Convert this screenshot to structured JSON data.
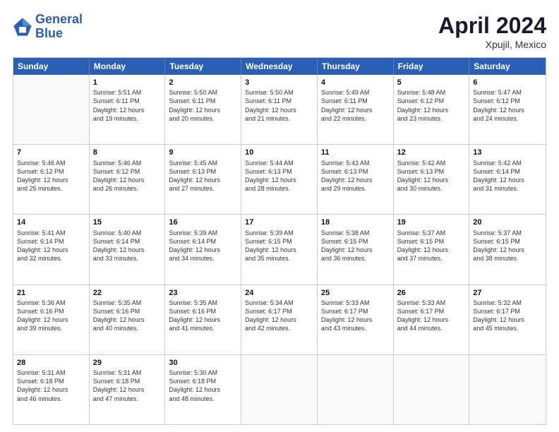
{
  "header": {
    "logo_general": "General",
    "logo_blue": "Blue",
    "title": "April 2024",
    "subtitle": "Xpujil, Mexico"
  },
  "days_of_week": [
    "Sunday",
    "Monday",
    "Tuesday",
    "Wednesday",
    "Thursday",
    "Friday",
    "Saturday"
  ],
  "weeks": [
    [
      {
        "day": "",
        "info": ""
      },
      {
        "day": "1",
        "info": "Sunrise: 5:51 AM\nSunset: 6:11 PM\nDaylight: 12 hours\nand 19 minutes."
      },
      {
        "day": "2",
        "info": "Sunrise: 5:50 AM\nSunset: 6:11 PM\nDaylight: 12 hours\nand 20 minutes."
      },
      {
        "day": "3",
        "info": "Sunrise: 5:50 AM\nSunset: 6:11 PM\nDaylight: 12 hours\nand 21 minutes."
      },
      {
        "day": "4",
        "info": "Sunrise: 5:49 AM\nSunset: 6:11 PM\nDaylight: 12 hours\nand 22 minutes."
      },
      {
        "day": "5",
        "info": "Sunrise: 5:48 AM\nSunset: 6:12 PM\nDaylight: 12 hours\nand 23 minutes."
      },
      {
        "day": "6",
        "info": "Sunrise: 5:47 AM\nSunset: 6:12 PM\nDaylight: 12 hours\nand 24 minutes."
      }
    ],
    [
      {
        "day": "7",
        "info": "Sunrise: 5:46 AM\nSunset: 6:12 PM\nDaylight: 12 hours\nand 25 minutes."
      },
      {
        "day": "8",
        "info": "Sunrise: 5:46 AM\nSunset: 6:12 PM\nDaylight: 12 hours\nand 26 minutes."
      },
      {
        "day": "9",
        "info": "Sunrise: 5:45 AM\nSunset: 6:13 PM\nDaylight: 12 hours\nand 27 minutes."
      },
      {
        "day": "10",
        "info": "Sunrise: 5:44 AM\nSunset: 6:13 PM\nDaylight: 12 hours\nand 28 minutes."
      },
      {
        "day": "11",
        "info": "Sunrise: 5:43 AM\nSunset: 6:13 PM\nDaylight: 12 hours\nand 29 minutes."
      },
      {
        "day": "12",
        "info": "Sunrise: 5:42 AM\nSunset: 6:13 PM\nDaylight: 12 hours\nand 30 minutes."
      },
      {
        "day": "13",
        "info": "Sunrise: 5:42 AM\nSunset: 6:14 PM\nDaylight: 12 hours\nand 31 minutes."
      }
    ],
    [
      {
        "day": "14",
        "info": "Sunrise: 5:41 AM\nSunset: 6:14 PM\nDaylight: 12 hours\nand 32 minutes."
      },
      {
        "day": "15",
        "info": "Sunrise: 5:40 AM\nSunset: 6:14 PM\nDaylight: 12 hours\nand 33 minutes."
      },
      {
        "day": "16",
        "info": "Sunrise: 5:39 AM\nSunset: 6:14 PM\nDaylight: 12 hours\nand 34 minutes."
      },
      {
        "day": "17",
        "info": "Sunrise: 5:39 AM\nSunset: 6:15 PM\nDaylight: 12 hours\nand 35 minutes."
      },
      {
        "day": "18",
        "info": "Sunrise: 5:38 AM\nSunset: 6:15 PM\nDaylight: 12 hours\nand 36 minutes."
      },
      {
        "day": "19",
        "info": "Sunrise: 5:37 AM\nSunset: 6:15 PM\nDaylight: 12 hours\nand 37 minutes."
      },
      {
        "day": "20",
        "info": "Sunrise: 5:37 AM\nSunset: 6:15 PM\nDaylight: 12 hours\nand 38 minutes."
      }
    ],
    [
      {
        "day": "21",
        "info": "Sunrise: 5:36 AM\nSunset: 6:16 PM\nDaylight: 12 hours\nand 39 minutes."
      },
      {
        "day": "22",
        "info": "Sunrise: 5:35 AM\nSunset: 6:16 PM\nDaylight: 12 hours\nand 40 minutes."
      },
      {
        "day": "23",
        "info": "Sunrise: 5:35 AM\nSunset: 6:16 PM\nDaylight: 12 hours\nand 41 minutes."
      },
      {
        "day": "24",
        "info": "Sunrise: 5:34 AM\nSunset: 6:17 PM\nDaylight: 12 hours\nand 42 minutes."
      },
      {
        "day": "25",
        "info": "Sunrise: 5:33 AM\nSunset: 6:17 PM\nDaylight: 12 hours\nand 43 minutes."
      },
      {
        "day": "26",
        "info": "Sunrise: 5:33 AM\nSunset: 6:17 PM\nDaylight: 12 hours\nand 44 minutes."
      },
      {
        "day": "27",
        "info": "Sunrise: 5:32 AM\nSunset: 6:17 PM\nDaylight: 12 hours\nand 45 minutes."
      }
    ],
    [
      {
        "day": "28",
        "info": "Sunrise: 5:31 AM\nSunset: 6:18 PM\nDaylight: 12 hours\nand 46 minutes."
      },
      {
        "day": "29",
        "info": "Sunrise: 5:31 AM\nSunset: 6:18 PM\nDaylight: 12 hours\nand 47 minutes."
      },
      {
        "day": "30",
        "info": "Sunrise: 5:30 AM\nSunset: 6:18 PM\nDaylight: 12 hours\nand 48 minutes."
      },
      {
        "day": "",
        "info": ""
      },
      {
        "day": "",
        "info": ""
      },
      {
        "day": "",
        "info": ""
      },
      {
        "day": "",
        "info": ""
      }
    ]
  ]
}
